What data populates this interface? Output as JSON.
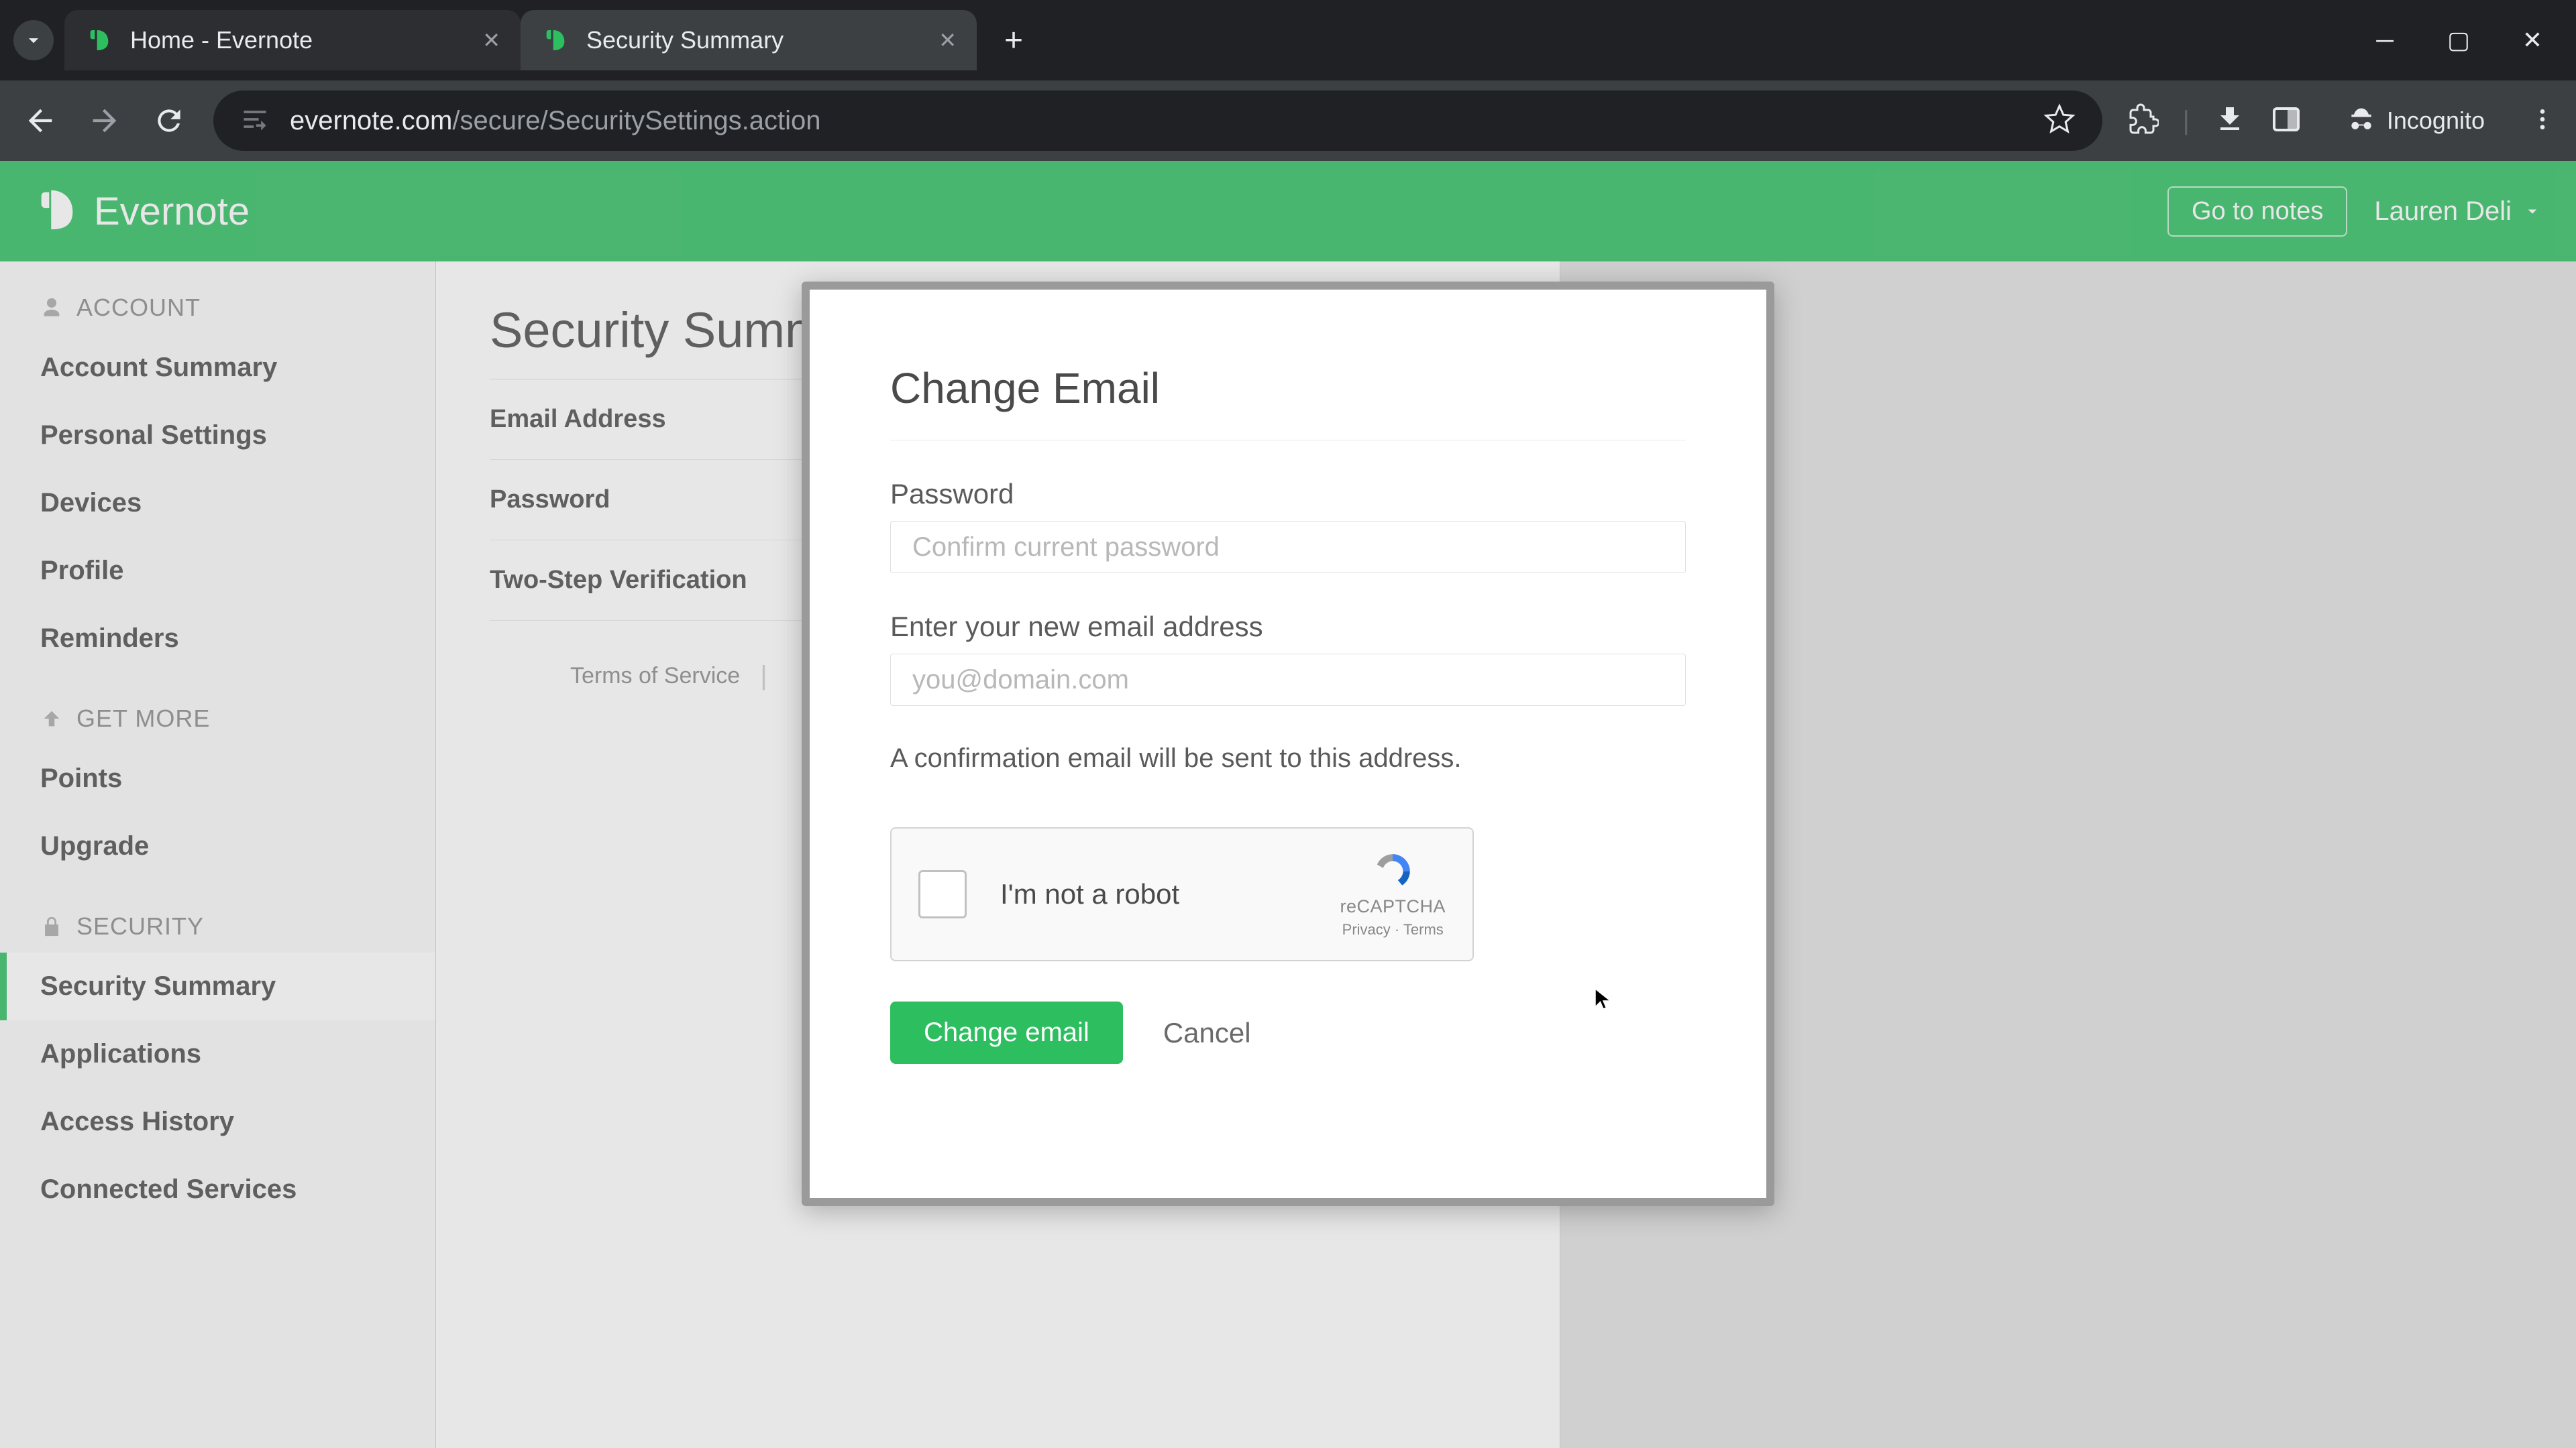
{
  "browser": {
    "tabs": [
      {
        "title": "Home - Evernote",
        "favicon": "evernote"
      },
      {
        "title": "Security Summary",
        "favicon": "evernote"
      }
    ],
    "url_domain": "evernote.com",
    "url_path": "/secure/SecuritySettings.action",
    "incognito_label": "Incognito"
  },
  "header": {
    "brand": "Evernote",
    "go_to_notes": "Go to notes",
    "user_name": "Lauren Deli"
  },
  "sidebar": {
    "sections": {
      "account_label": "ACCOUNT",
      "getmore_label": "GET MORE",
      "security_label": "SECURITY"
    },
    "items": {
      "account_summary": "Account Summary",
      "personal_settings": "Personal Settings",
      "devices": "Devices",
      "profile": "Profile",
      "reminders": "Reminders",
      "points": "Points",
      "upgrade": "Upgrade",
      "security_summary": "Security Summary",
      "applications": "Applications",
      "access_history": "Access History",
      "connected_services": "Connected Services"
    }
  },
  "main": {
    "title": "Security Summary",
    "rows": {
      "email_address": "Email Address",
      "password": "Password",
      "two_step": "Two-Step Verification"
    },
    "footer": {
      "terms": "Terms of Service"
    }
  },
  "modal": {
    "title": "Change Email",
    "password_label": "Password",
    "password_placeholder": "Confirm current password",
    "email_label": "Enter your new email address",
    "email_placeholder": "you@domain.com",
    "note": "A confirmation email will be sent to this address.",
    "recaptcha_label": "I'm not a robot",
    "recaptcha_brand": "reCAPTCHA",
    "recaptcha_links": "Privacy · Terms",
    "submit": "Change email",
    "cancel": "Cancel"
  }
}
